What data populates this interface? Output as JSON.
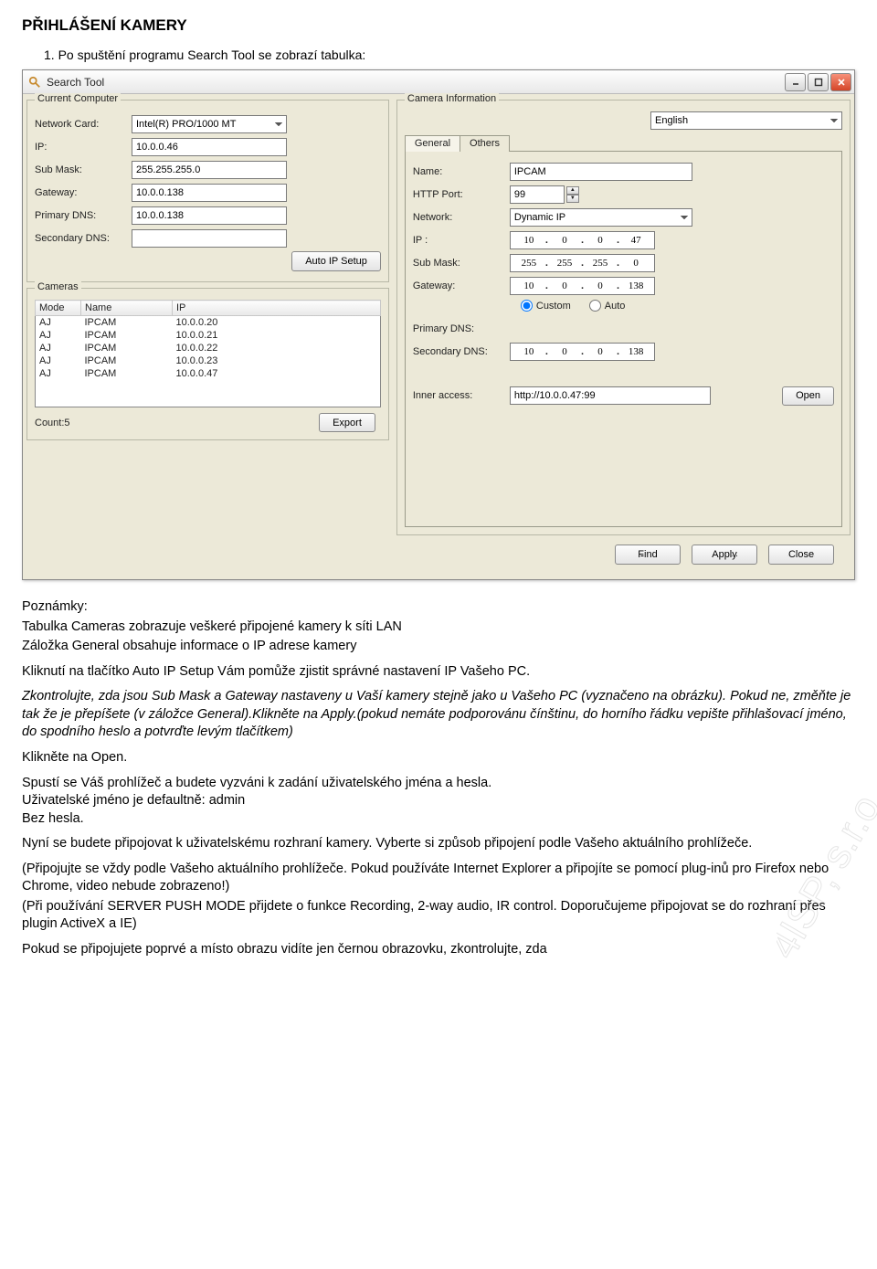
{
  "page_title": "PŘIHLÁŠENÍ KAMERY",
  "intro_line": "1. Po spuštění programu Search Tool se zobrazí tabulka:",
  "app": {
    "title": "Search Tool",
    "language_value": "English",
    "groups": {
      "current_computer": "Current Computer",
      "cameras": "Cameras",
      "camera_information": "Camera Information"
    },
    "left_labels": {
      "network_card": "Network Card:",
      "ip": "IP:",
      "sub_mask": "Sub Mask:",
      "gateway": "Gateway:",
      "primary_dns": "Primary DNS:",
      "secondary_dns": "Secondary DNS:"
    },
    "left_values": {
      "network_card": "Intel(R) PRO/1000 MT",
      "ip": "10.0.0.46",
      "sub_mask": "255.255.255.0",
      "gateway": "10.0.0.138",
      "primary_dns": "10.0.0.138",
      "secondary_dns": ""
    },
    "auto_ip_setup_btn": "Auto IP Setup",
    "camera_table": {
      "headers": {
        "mode": "Mode",
        "name": "Name",
        "ip": "IP"
      },
      "rows": [
        {
          "mode": "AJ",
          "name": "IPCAM",
          "ip": "10.0.0.20"
        },
        {
          "mode": "AJ",
          "name": "IPCAM",
          "ip": "10.0.0.21"
        },
        {
          "mode": "AJ",
          "name": "IPCAM",
          "ip": "10.0.0.22"
        },
        {
          "mode": "AJ",
          "name": "IPCAM",
          "ip": "10.0.0.23"
        },
        {
          "mode": "AJ",
          "name": "IPCAM",
          "ip": "10.0.0.47"
        }
      ]
    },
    "count_label": "Count:5",
    "export_btn": "Export",
    "tabs": {
      "general": "General",
      "others": "Others"
    },
    "right_labels": {
      "name": "Name:",
      "http_port": "HTTP Port:",
      "network": "Network:",
      "ip": "IP  :",
      "sub_mask": "Sub Mask:",
      "gateway": "Gateway:",
      "primary_dns": "Primary DNS:",
      "secondary_dns": "Secondary DNS:",
      "inner_access": "Inner access:"
    },
    "right_values": {
      "name": "IPCAM",
      "http_port": "99",
      "network": "Dynamic IP",
      "ip": [
        "10",
        "0",
        "0",
        "47"
      ],
      "sub_mask": [
        "255",
        "255",
        "255",
        "0"
      ],
      "gateway": [
        "10",
        "0",
        "0",
        "138"
      ],
      "secondary_dns": [
        "10",
        "0",
        "0",
        "138"
      ],
      "inner_access": "http://10.0.0.47:99"
    },
    "radio": {
      "custom": "Custom",
      "auto": "Auto"
    },
    "open_btn": "Open",
    "find_btn": "Find",
    "apply_btn": "Apply",
    "close_btn": "Close"
  },
  "body": {
    "notes_title": "Poznámky:",
    "note1": "Tabulka Cameras zobrazuje veškeré připojené kamery k síti LAN",
    "note2": "Záložka General obsahuje informace o IP adrese kamery",
    "p1": "Kliknutí na tlačítko Auto IP Setup Vám pomůže zjistit správné nastavení IP Vašeho PC.",
    "p2": "Zkontrolujte, zda jsou Sub Mask a Gateway nastaveny u Vaší kamery stejně jako u Vašeho PC (vyznačeno na obrázku). Pokud ne, změňte je tak že je přepíšete (v záložce General).Klikněte na Apply.(pokud nemáte podporovánu čínštinu, do horního řádku vepište přihlašovací jméno, do spodního heslo a potvrďte levým tlačítkem)",
    "p3": "Klikněte na Open.",
    "p4a": "Spustí se Váš prohlížeč a budete vyzváni k zadání uživatelského jména a hesla.",
    "p4b": "Uživatelské jméno je defaultně: admin",
    "p4c": "Bez hesla.",
    "p5": "Nyní se budete připojovat k uživatelskému rozhraní kamery. Vyberte si způsob připojení podle Vašeho aktuálního prohlížeče.",
    "p6": "(Připojujte se vždy podle Vašeho aktuálního prohlížeče. Pokud používáte Internet Explorer a připojíte se pomocí plug-inů pro Firefox nebo Chrome, video nebude zobrazeno!)",
    "p7": "(Při používání SERVER PUSH MODE přijdete o funkce Recording, 2-way audio, IR control. Doporučujeme připojovat se do rozhraní přes plugin ActiveX a IE)",
    "p8": "Pokud se připojujete poprvé a místo obrazu vidíte jen černou obrazovku, zkontrolujte, zda"
  },
  "watermark": "4ISP, s.r.o."
}
